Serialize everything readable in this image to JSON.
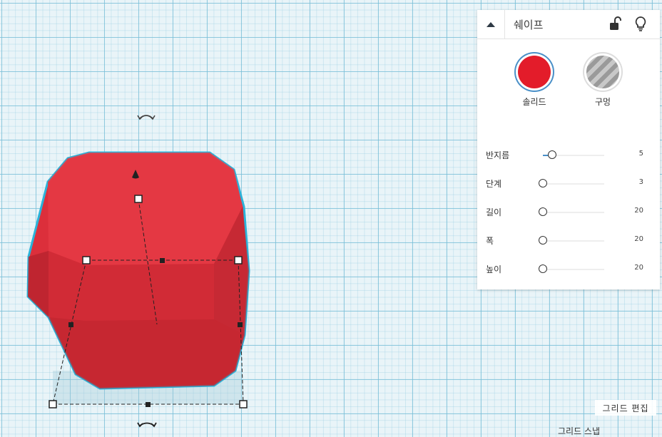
{
  "panel": {
    "title": "쉐이프",
    "collapse_icon": "caret-up-icon",
    "lock_icon": "unlock-icon",
    "light_icon": "lightbulb-icon",
    "solid_label": "솔리드",
    "hole_label": "구멍",
    "solid_color": "#e31c2a",
    "selected_type": "솔리드",
    "params": [
      {
        "label": "반지름",
        "value": "5",
        "fill": 0.15
      },
      {
        "label": "단계",
        "value": "3",
        "fill": 0.0
      },
      {
        "label": "길이",
        "value": "20",
        "fill": 0.0
      },
      {
        "label": "폭",
        "value": "20",
        "fill": 0.0
      },
      {
        "label": "높이",
        "value": "20",
        "fill": 0.0
      }
    ]
  },
  "workplane": {
    "shape_color": "#e0303c",
    "selection_outline_color": "#2bb3d9",
    "grid_edit_label": "그리드 편집",
    "grid_snap_label": "그리드 스냅"
  }
}
